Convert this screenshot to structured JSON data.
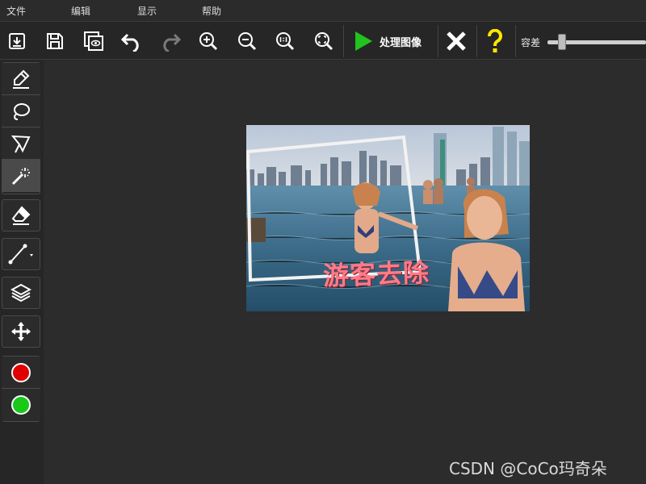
{
  "menu": {
    "items": [
      {
        "label": "文件"
      },
      {
        "label": "编辑"
      },
      {
        "label": "显示"
      },
      {
        "label": "帮助"
      }
    ]
  },
  "toolbar": {
    "icons": [
      "import-icon",
      "save-icon",
      "copy-preview-icon",
      "undo-icon",
      "redo-icon",
      "zoom-in-icon",
      "zoom-out-icon",
      "zoom-actual-icon",
      "zoom-fit-icon"
    ],
    "process_label": "处理图像",
    "tolerance_label": "容差",
    "tolerance_level": 0.15,
    "colors": {
      "play": "#22c21f",
      "help": "#ffe600",
      "close": "#ffffff"
    }
  },
  "tools": {
    "icons": [
      "marker-icon",
      "lasso-icon",
      "polygon-lasso-icon",
      "magic-wand-icon",
      "eraser-icon",
      "line-icon",
      "layers-icon",
      "move-icon"
    ],
    "active": "magic-wand-icon",
    "colors": {
      "red": "#e00000",
      "green": "#18c918"
    }
  },
  "image": {
    "caption": "游客去除"
  },
  "watermark": "CSDN @CoCo玛奇朵"
}
